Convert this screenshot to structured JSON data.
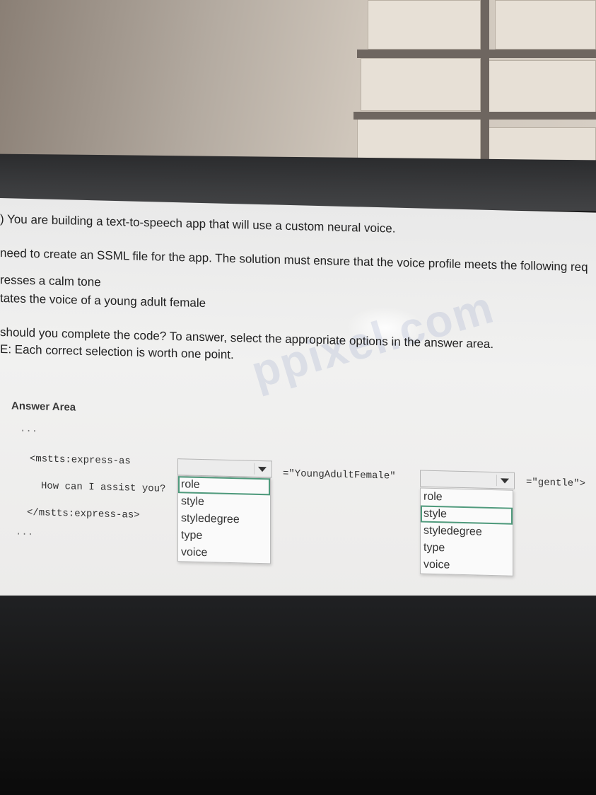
{
  "question": {
    "line1": ") You are building a text-to-speech app that will use a custom neural voice.",
    "line2": " need to create an SSML file for the app. The solution must ensure that the voice profile meets the following req",
    "req1": "resses a calm tone",
    "req2": "tates the voice of a young adult female",
    "line3": " should you complete the code? To answer, select the appropriate options in the answer area.",
    "line4": "E: Each correct selection is worth one point."
  },
  "answer_area": {
    "title": "Answer Area",
    "ellipsis_top": "...",
    "open_tag": "<mstts:express-as",
    "body_text": "How can I assist you?",
    "close_tag": "</mstts:express-as>",
    "ellipsis_bottom": "...",
    "value1": "=\"YoungAdultFemale\"",
    "value2": "=\"gentle\">"
  },
  "dropdown1": {
    "options": [
      "role",
      "style",
      "styledegree",
      "type",
      "voice"
    ],
    "selected_index": 0
  },
  "dropdown2": {
    "options": [
      "role",
      "style",
      "styledegree",
      "type",
      "voice"
    ],
    "selected_index": 1
  },
  "watermark": "ppixel.com",
  "colors": {
    "selection_outline": "#4f9a7c",
    "screen_bg": "#ececec"
  }
}
